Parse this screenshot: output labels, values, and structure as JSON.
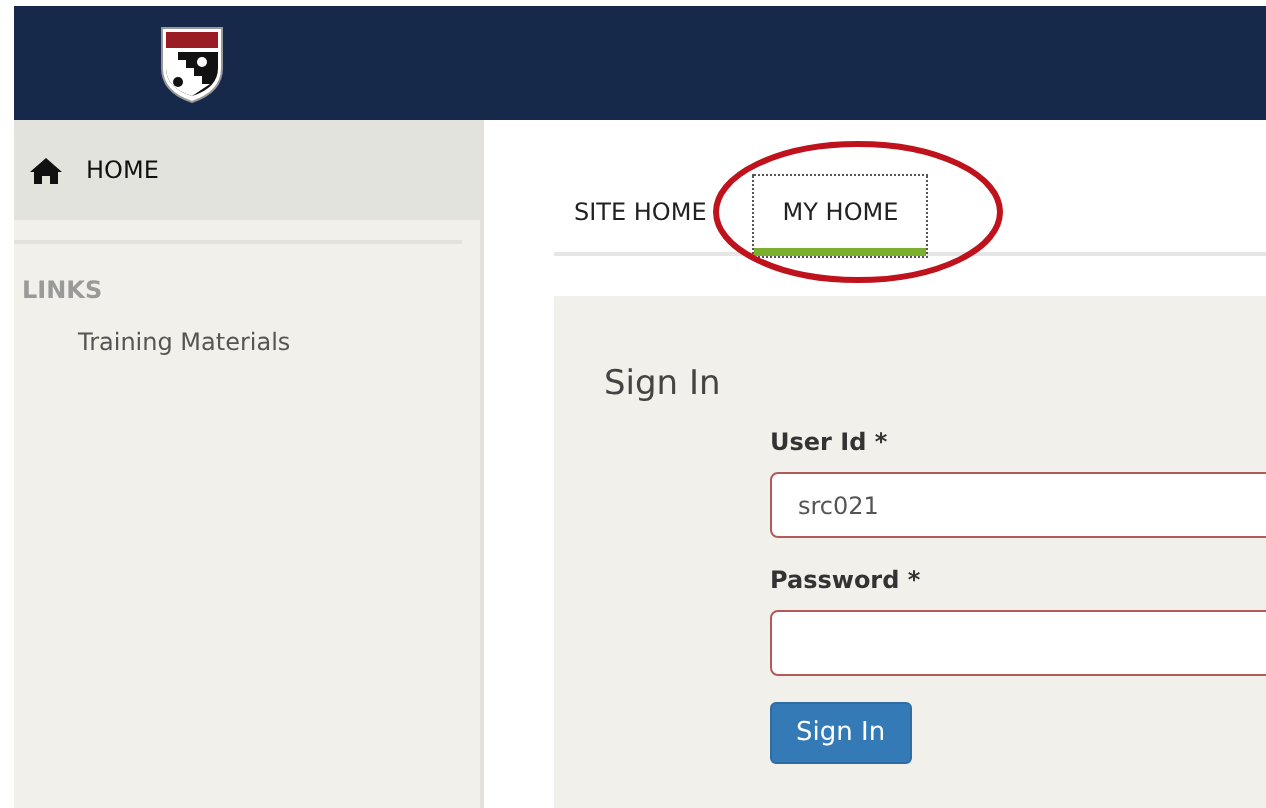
{
  "sidebar": {
    "home": {
      "label": "HOME",
      "selected": true
    },
    "section_title": "LINKS",
    "links": [
      "Training Materials"
    ]
  },
  "tabs": [
    {
      "label": "SITE HOME",
      "selected": false
    },
    {
      "label": "MY HOME",
      "selected": true
    }
  ],
  "annotation": {
    "kind": "ellipse",
    "color": "#c0121c"
  },
  "sign_in": {
    "title": "Sign In",
    "fields": [
      {
        "label": "User Id *",
        "value": "src021",
        "invalid": true
      },
      {
        "label": "Password *",
        "invalid": true
      }
    ],
    "button": "Sign In"
  }
}
